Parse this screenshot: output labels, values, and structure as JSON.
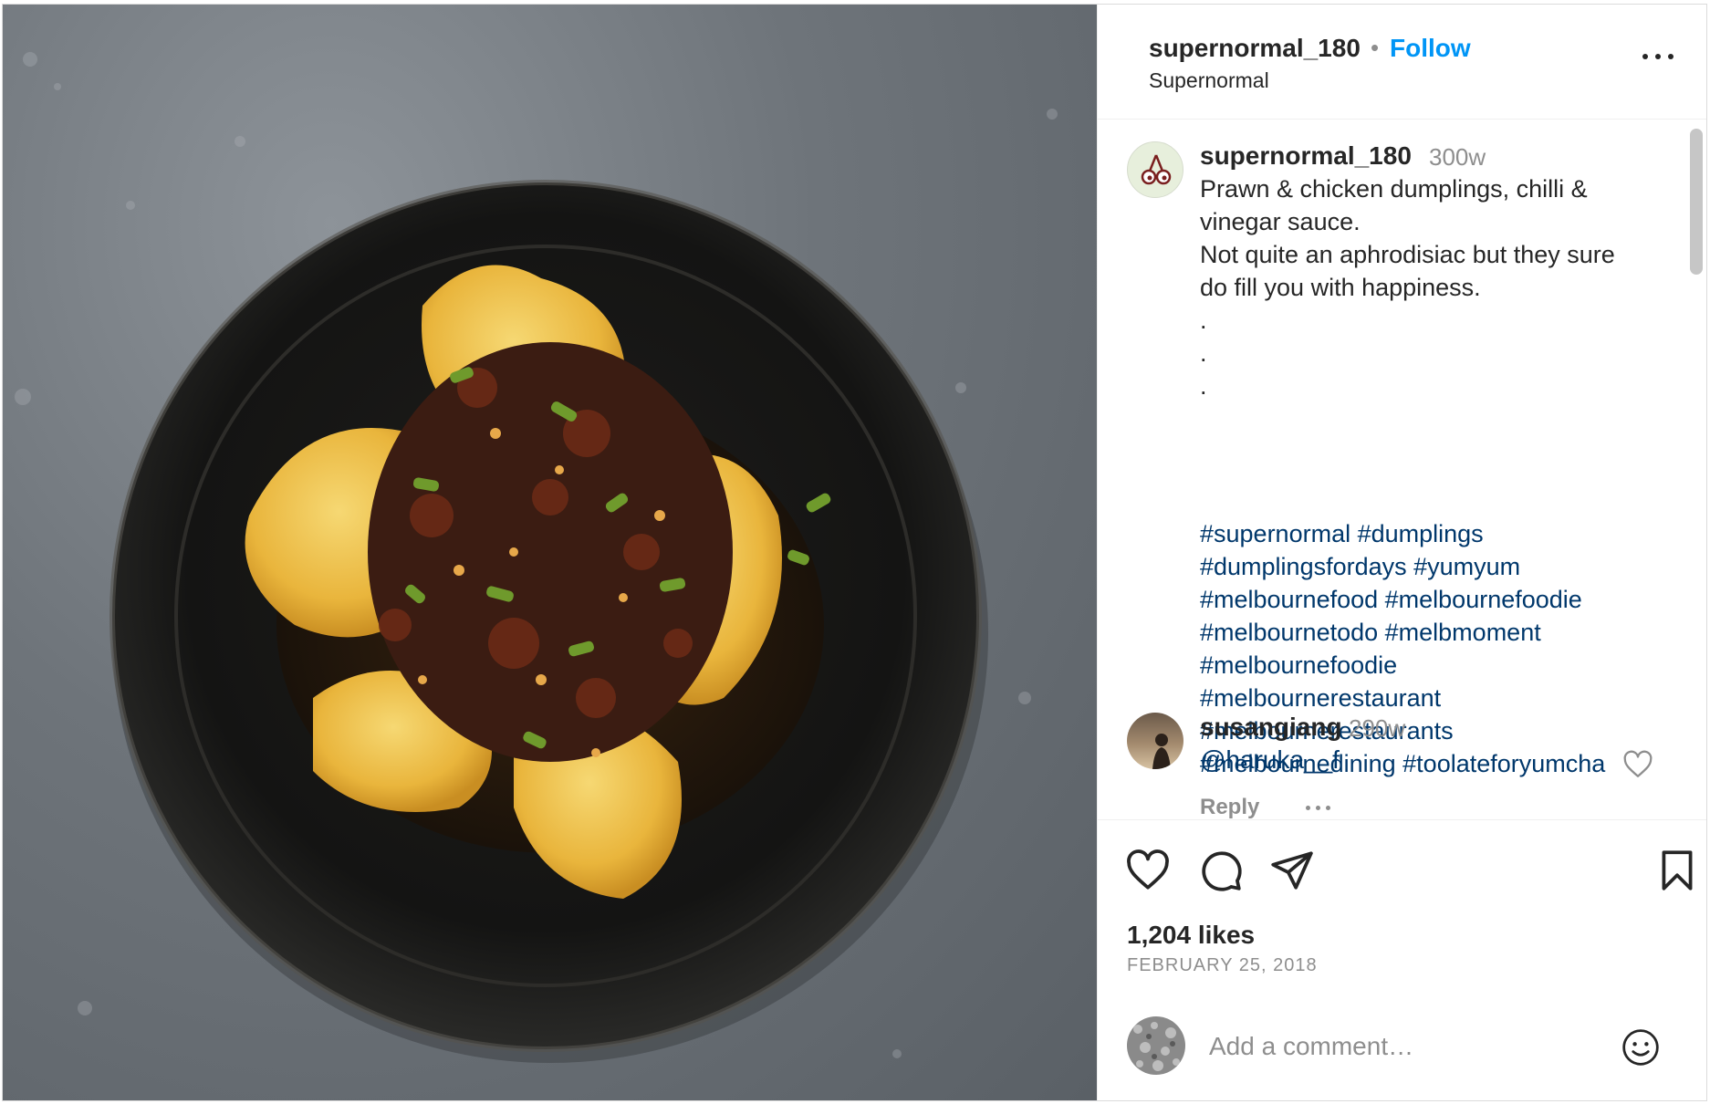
{
  "header": {
    "username": "supernormal_180",
    "separator": "•",
    "follow_label": "Follow",
    "subtitle": "Supernormal"
  },
  "caption": {
    "username": "supernormal_180",
    "time": "300w",
    "lines": [
      "Prawn & chicken dumplings, chilli &",
      "vinegar sauce.",
      "Not quite an aphrodisiac but they sure",
      "do fill you with happiness.",
      ".",
      ".",
      "."
    ],
    "hashtag_lines": [
      "#supernormal #dumplings",
      "#dumplingsfordays #yumyum",
      "#melbournefood #melbournefoodie",
      "#melbournetodo #melbmoment",
      "#melbournefoodie",
      "#melbournerestaurant",
      "#melbournerestaurants",
      "#melbournedining #toolateforyumcha"
    ]
  },
  "comment": {
    "username": "susangiang",
    "time": "290w",
    "text": "@haruka__f",
    "reply_label": "Reply"
  },
  "stats": {
    "likes": "1,204 likes",
    "date": "FEBRUARY 25, 2018"
  },
  "composer": {
    "placeholder": "Add a comment…"
  },
  "icons": {
    "more": "more-icon",
    "like": "heart-icon",
    "comment": "comment-icon",
    "share": "share-icon",
    "save": "bookmark-icon",
    "emoji": "emoji-icon",
    "comment_like": "heart-icon"
  },
  "colors": {
    "link_blue": "#0095f6",
    "hashtag": "#00376b",
    "muted": "#8e8e8e"
  }
}
